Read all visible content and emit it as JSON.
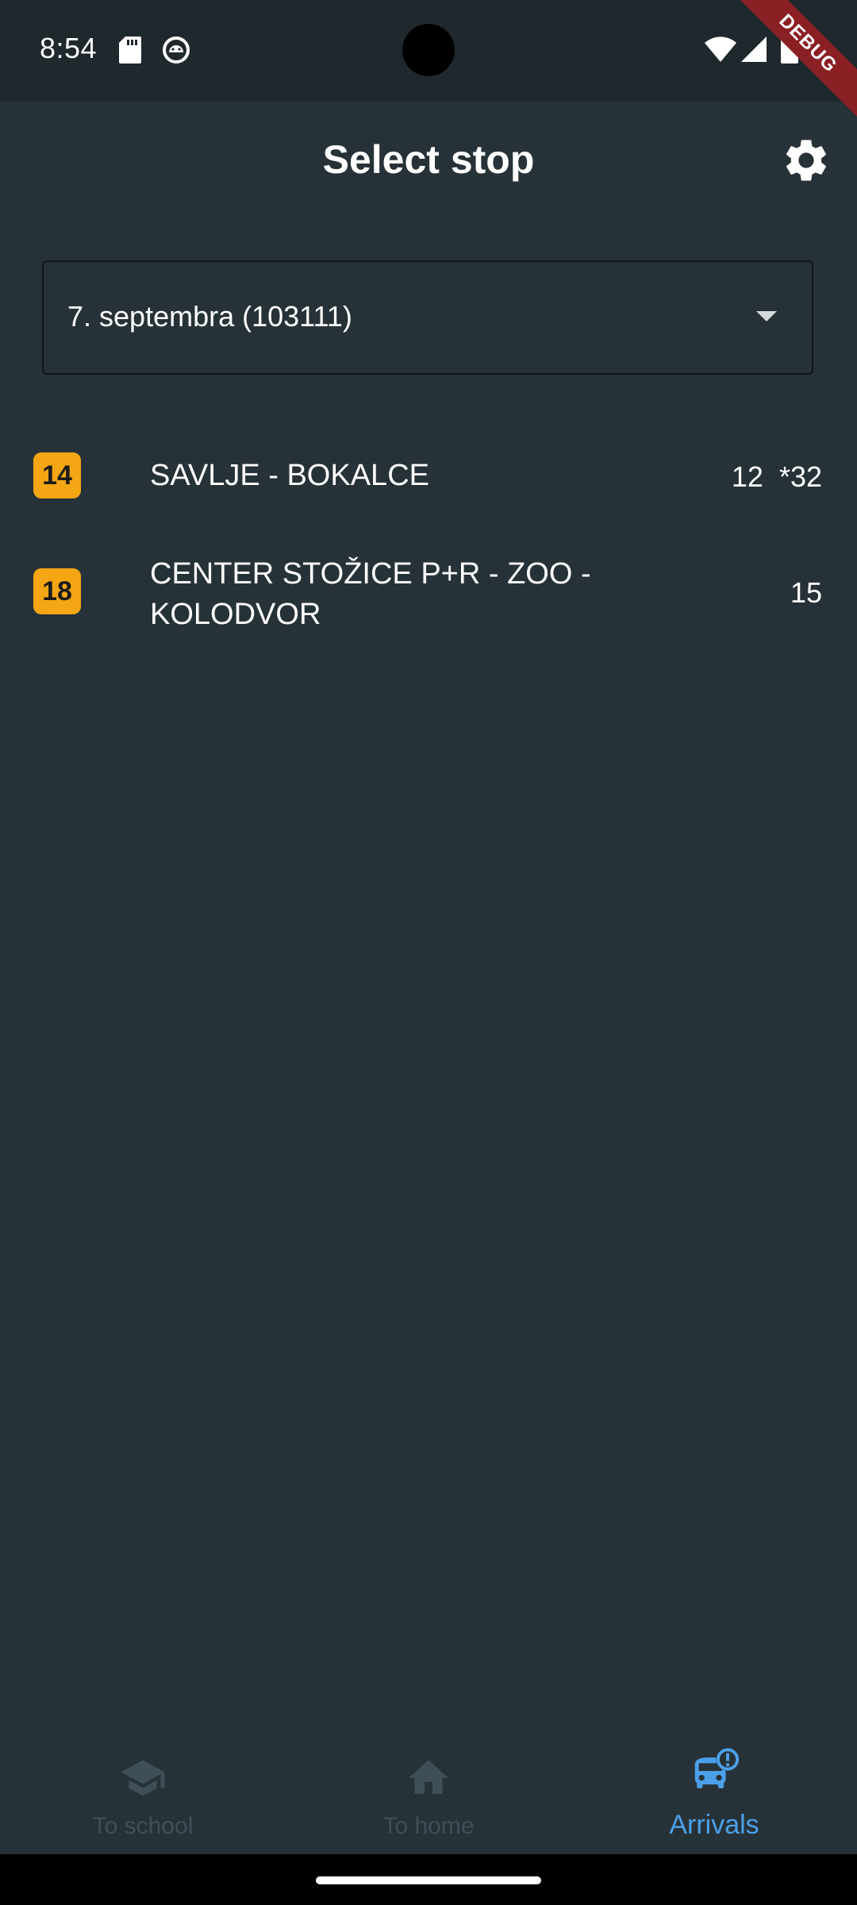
{
  "status_bar": {
    "time": "8:54",
    "icons": [
      "sd-card-icon",
      "android-debug-icon",
      "wifi-icon",
      "cell-signal-icon",
      "battery-icon"
    ]
  },
  "debug_banner": "DEBUG",
  "app_bar": {
    "title": "Select stop",
    "settings_icon": "gear-icon"
  },
  "stop_selector": {
    "selected": "7. septembra (103111)",
    "caret_icon": "caret-down-icon"
  },
  "routes": [
    {
      "number": "14",
      "name": "SAVLJE - BOKALCE",
      "times": "12  *32"
    },
    {
      "number": "18",
      "name": "CENTER STOŽICE P+R - ZOO - KOLODVOR",
      "times": "15"
    }
  ],
  "bottom_nav": {
    "items": [
      {
        "label": "To school",
        "icon": "graduation-cap-icon",
        "active": false
      },
      {
        "label": "To home",
        "icon": "home-icon",
        "active": false
      },
      {
        "label": "Arrivals",
        "icon": "bus-alert-icon",
        "active": true
      }
    ]
  },
  "colors": {
    "background": "#273238",
    "status_bar": "#1f282d",
    "badge": "#f5a614",
    "active_nav": "#4aa1ea",
    "inactive_nav": "#3f4f58",
    "debug_ribbon": "#8a1f24"
  }
}
